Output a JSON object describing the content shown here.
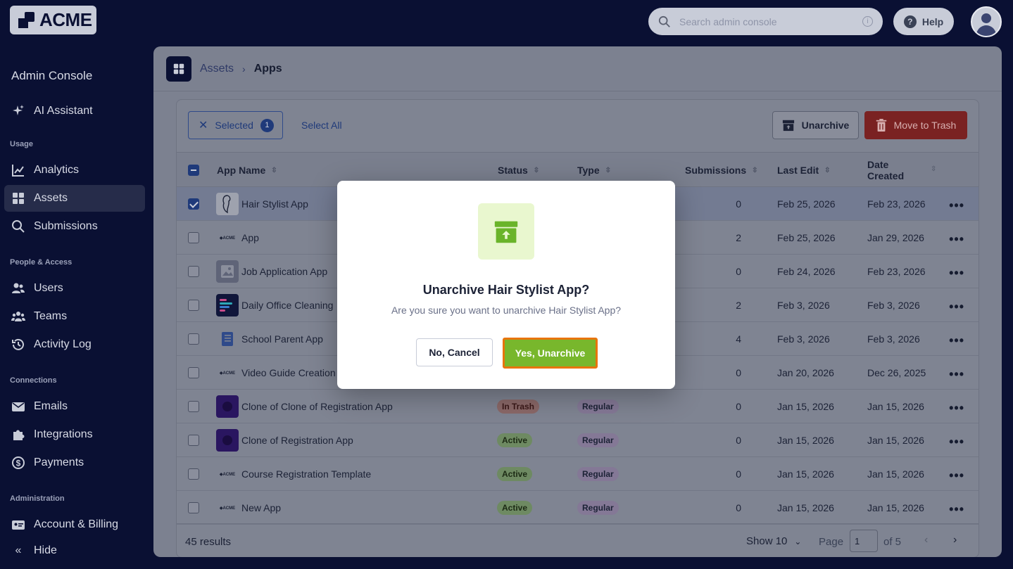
{
  "brand": {
    "logo_text": "ACME"
  },
  "topbar": {
    "search_placeholder": "Search admin console",
    "help_label": "Help"
  },
  "sidebar": {
    "title": "Admin Console",
    "ai_assistant": "AI Assistant",
    "sections": {
      "usage": "Usage",
      "people": "People & Access",
      "connections": "Connections",
      "administration": "Administration"
    },
    "items": {
      "analytics": "Analytics",
      "assets": "Assets",
      "submissions": "Submissions",
      "users": "Users",
      "teams": "Teams",
      "activity_log": "Activity Log",
      "emails": "Emails",
      "integrations": "Integrations",
      "payments": "Payments",
      "account_billing": "Account & Billing",
      "hide": "Hide"
    }
  },
  "breadcrumb": {
    "parent": "Assets",
    "current": "Apps"
  },
  "toolbar": {
    "selected_label": "Selected",
    "selected_count": "1",
    "select_all": "Select All",
    "unarchive": "Unarchive",
    "move_to_trash": "Move to Trash"
  },
  "columns": {
    "app_name": "App Name",
    "status": "Status",
    "type": "Type",
    "submissions": "Submissions",
    "last_edit": "Last Edit",
    "date_created": "Date Created"
  },
  "rows": [
    {
      "name": "Hair Stylist App",
      "status": "",
      "type": "",
      "submissions": "0",
      "last_edit": "Feb 25, 2026",
      "date_created": "Feb 23, 2026"
    },
    {
      "name": "App",
      "status": "",
      "type": "",
      "submissions": "2",
      "last_edit": "Feb 25, 2026",
      "date_created": "Jan 29, 2026"
    },
    {
      "name": "Job Application App",
      "status": "",
      "type": "",
      "submissions": "0",
      "last_edit": "Feb 24, 2026",
      "date_created": "Feb 23, 2026"
    },
    {
      "name": "Daily Office Cleaning",
      "status": "",
      "type": "",
      "submissions": "2",
      "last_edit": "Feb 3, 2026",
      "date_created": "Feb 3, 2026"
    },
    {
      "name": "School Parent App",
      "status": "",
      "type": "",
      "submissions": "4",
      "last_edit": "Feb 3, 2026",
      "date_created": "Feb 3, 2026"
    },
    {
      "name": "Video Guide Creation",
      "status": "",
      "type": "",
      "submissions": "0",
      "last_edit": "Jan 20, 2026",
      "date_created": "Dec 26, 2025"
    },
    {
      "name": "Clone of Clone of Registration App",
      "status": "In Trash",
      "type": "Regular",
      "submissions": "0",
      "last_edit": "Jan 15, 2026",
      "date_created": "Jan 15, 2026"
    },
    {
      "name": "Clone of Registration App",
      "status": "Active",
      "type": "Regular",
      "submissions": "0",
      "last_edit": "Jan 15, 2026",
      "date_created": "Jan 15, 2026"
    },
    {
      "name": "Course Registration Template",
      "status": "Active",
      "type": "Regular",
      "submissions": "0",
      "last_edit": "Jan 15, 2026",
      "date_created": "Jan 15, 2026"
    },
    {
      "name": "New App",
      "status": "Active",
      "type": "Regular",
      "submissions": "0",
      "last_edit": "Jan 15, 2026",
      "date_created": "Jan 15, 2026"
    }
  ],
  "footer": {
    "results": "45 results",
    "show": "Show 10",
    "page_label": "Page",
    "page_value": "1",
    "of_label": "of 5"
  },
  "modal": {
    "title": "Unarchive Hair Stylist App?",
    "message": "Are you sure you want to unarchive Hair Stylist App?",
    "cancel": "No, Cancel",
    "confirm": "Yes, Unarchive"
  },
  "colors": {
    "sidebar_bg": "#0a1033",
    "accent": "#1f3a7a",
    "danger": "#c62828",
    "confirm": "#78b72c",
    "confirm_outline": "#e8740c"
  }
}
